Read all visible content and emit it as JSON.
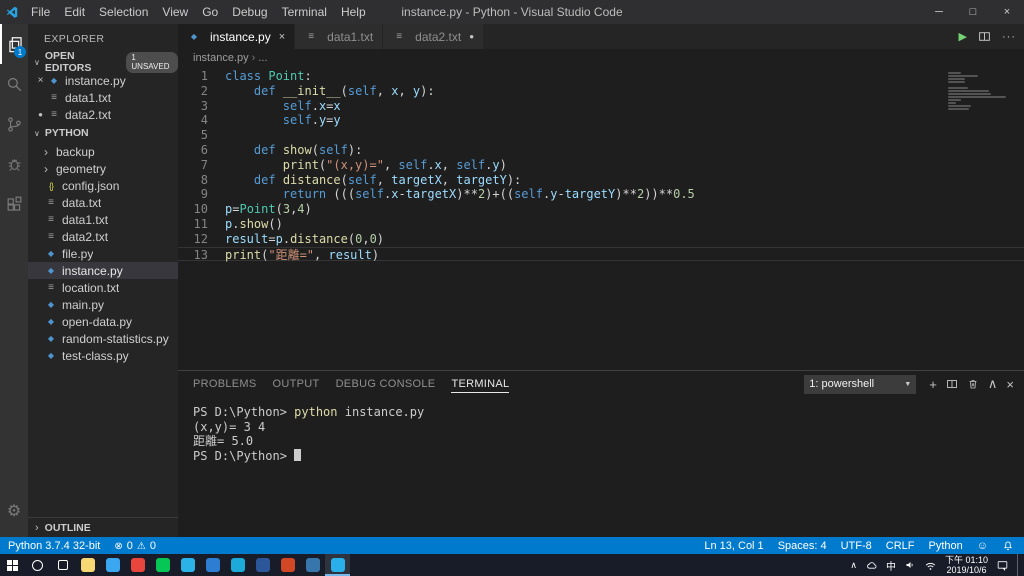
{
  "colors": {
    "accent": "#007acc",
    "token": {
      "k": "#569cd6",
      "c": "#4ec9b0",
      "f": "#dcdcaa",
      "v": "#9cdcfe",
      "s": "#ce9178",
      "d": "#b5cea8",
      "p": "#d4d4d4",
      "y": "#dcdcaa",
      "t": "#cccccc"
    }
  },
  "titlebar": {
    "title": "instance.py - Python - Visual Studio Code",
    "menus": [
      "File",
      "Edit",
      "Selection",
      "View",
      "Go",
      "Debug",
      "Terminal",
      "Help"
    ],
    "controls": {
      "minimize": "─",
      "maximize": "□",
      "close": "×"
    }
  },
  "activity_bar": {
    "badge": "1",
    "items": [
      "explorer",
      "search",
      "source-control",
      "debug",
      "extensions",
      "settings"
    ]
  },
  "sidebar": {
    "title": "EXPLORER",
    "open_editors": {
      "label": "OPEN EDITORS",
      "badge": "1 UNSAVED",
      "items": [
        {
          "name": "instance.py",
          "type": "py",
          "close": true
        },
        {
          "name": "data1.txt",
          "type": "txt"
        },
        {
          "name": "data2.txt",
          "type": "txt",
          "dirty": true
        }
      ]
    },
    "folder": {
      "label": "PYTHON",
      "items": [
        {
          "name": "backup",
          "type": "folder"
        },
        {
          "name": "geometry",
          "type": "folder"
        },
        {
          "name": "config.json",
          "type": "json"
        },
        {
          "name": "data.txt",
          "type": "txt"
        },
        {
          "name": "data1.txt",
          "type": "txt"
        },
        {
          "name": "data2.txt",
          "type": "txt"
        },
        {
          "name": "file.py",
          "type": "py"
        },
        {
          "name": "instance.py",
          "type": "py",
          "selected": true
        },
        {
          "name": "location.txt",
          "type": "txt"
        },
        {
          "name": "main.py",
          "type": "py"
        },
        {
          "name": "open-data.py",
          "type": "py"
        },
        {
          "name": "random-statistics.py",
          "type": "py"
        },
        {
          "name": "test-class.py",
          "type": "py"
        }
      ]
    },
    "outline_label": "OUTLINE"
  },
  "editor": {
    "tabs": [
      {
        "label": "instance.py",
        "type": "py",
        "active": true,
        "close": true
      },
      {
        "label": "data1.txt",
        "type": "txt"
      },
      {
        "label": "data2.txt",
        "type": "txt",
        "dirty": true
      }
    ],
    "action_icons": {
      "run": "▶",
      "more": "···"
    },
    "breadcrumb": {
      "file": "instance.py",
      "more": "..."
    },
    "code": [
      {
        "num": 1,
        "tokens": [
          [
            "k",
            "class"
          ],
          [
            "p",
            " "
          ],
          [
            "c",
            "Point"
          ],
          [
            "p",
            ":"
          ]
        ]
      },
      {
        "num": 2,
        "tokens": [
          [
            "p",
            "    "
          ],
          [
            "k",
            "def"
          ],
          [
            "p",
            " "
          ],
          [
            "f",
            "__init__"
          ],
          [
            "p",
            "("
          ],
          [
            "k",
            "self"
          ],
          [
            "p",
            ", "
          ],
          [
            "v",
            "x"
          ],
          [
            "p",
            ", "
          ],
          [
            "v",
            "y"
          ],
          [
            "p",
            "):"
          ]
        ]
      },
      {
        "num": 3,
        "tokens": [
          [
            "p",
            "        "
          ],
          [
            "k",
            "self"
          ],
          [
            "p",
            "."
          ],
          [
            "v",
            "x"
          ],
          [
            "p",
            "="
          ],
          [
            "v",
            "x"
          ]
        ]
      },
      {
        "num": 4,
        "tokens": [
          [
            "p",
            "        "
          ],
          [
            "k",
            "self"
          ],
          [
            "p",
            "."
          ],
          [
            "v",
            "y"
          ],
          [
            "p",
            "="
          ],
          [
            "v",
            "y"
          ]
        ]
      },
      {
        "num": 5,
        "tokens": []
      },
      {
        "num": 6,
        "tokens": [
          [
            "p",
            "    "
          ],
          [
            "k",
            "def"
          ],
          [
            "p",
            " "
          ],
          [
            "f",
            "show"
          ],
          [
            "p",
            "("
          ],
          [
            "k",
            "self"
          ],
          [
            "p",
            "):"
          ]
        ]
      },
      {
        "num": 7,
        "tokens": [
          [
            "p",
            "        "
          ],
          [
            "f",
            "print"
          ],
          [
            "p",
            "("
          ],
          [
            "s",
            "\"(x,y)=\""
          ],
          [
            "p",
            ", "
          ],
          [
            "k",
            "self"
          ],
          [
            "p",
            "."
          ],
          [
            "v",
            "x"
          ],
          [
            "p",
            ", "
          ],
          [
            "k",
            "self"
          ],
          [
            "p",
            "."
          ],
          [
            "v",
            "y"
          ],
          [
            "p",
            ")"
          ]
        ]
      },
      {
        "num": 8,
        "tokens": [
          [
            "p",
            "    "
          ],
          [
            "k",
            "def"
          ],
          [
            "p",
            " "
          ],
          [
            "f",
            "distance"
          ],
          [
            "p",
            "("
          ],
          [
            "k",
            "self"
          ],
          [
            "p",
            ", "
          ],
          [
            "v",
            "targetX"
          ],
          [
            "p",
            ", "
          ],
          [
            "v",
            "targetY"
          ],
          [
            "p",
            "):"
          ]
        ]
      },
      {
        "num": 9,
        "tokens": [
          [
            "p",
            "        "
          ],
          [
            "k",
            "return"
          ],
          [
            "p",
            " ((("
          ],
          [
            "k",
            "self"
          ],
          [
            "p",
            "."
          ],
          [
            "v",
            "x"
          ],
          [
            "p",
            "-"
          ],
          [
            "v",
            "targetX"
          ],
          [
            "p",
            ")**"
          ],
          [
            "d",
            "2"
          ],
          [
            "p",
            ")+(("
          ],
          [
            "k",
            "self"
          ],
          [
            "p",
            "."
          ],
          [
            "v",
            "y"
          ],
          [
            "p",
            "-"
          ],
          [
            "v",
            "targetY"
          ],
          [
            "p",
            ")**"
          ],
          [
            "d",
            "2"
          ],
          [
            "p",
            "))**"
          ],
          [
            "d",
            "0.5"
          ]
        ]
      },
      {
        "num": 10,
        "tokens": [
          [
            "v",
            "p"
          ],
          [
            "p",
            "="
          ],
          [
            "c",
            "Point"
          ],
          [
            "p",
            "("
          ],
          [
            "d",
            "3"
          ],
          [
            "p",
            ","
          ],
          [
            "d",
            "4"
          ],
          [
            "p",
            ")"
          ]
        ]
      },
      {
        "num": 11,
        "tokens": [
          [
            "v",
            "p"
          ],
          [
            "p",
            "."
          ],
          [
            "f",
            "show"
          ],
          [
            "p",
            "()"
          ]
        ]
      },
      {
        "num": 12,
        "tokens": [
          [
            "v",
            "result"
          ],
          [
            "p",
            "="
          ],
          [
            "v",
            "p"
          ],
          [
            "p",
            "."
          ],
          [
            "f",
            "distance"
          ],
          [
            "p",
            "("
          ],
          [
            "d",
            "0"
          ],
          [
            "p",
            ","
          ],
          [
            "d",
            "0"
          ],
          [
            "p",
            ")"
          ]
        ]
      },
      {
        "num": 13,
        "tokens": [
          [
            "f",
            "print"
          ],
          [
            "p",
            "("
          ],
          [
            "s",
            "\"距離=\""
          ],
          [
            "p",
            ", "
          ],
          [
            "v",
            "result"
          ],
          [
            "p",
            ")"
          ]
        ],
        "current": true
      }
    ]
  },
  "panel": {
    "tabs": [
      {
        "label": "PROBLEMS"
      },
      {
        "label": "OUTPUT"
      },
      {
        "label": "DEBUG CONSOLE"
      },
      {
        "label": "TERMINAL",
        "active": true
      }
    ],
    "shell_select": "1: powershell",
    "icons": {
      "dropdown": "▼",
      "new": "+",
      "maximize": "∧",
      "close": "×"
    },
    "terminal": [
      {
        "tokens": [
          [
            "t",
            "PS D:\\Python> "
          ],
          [
            "y",
            "python"
          ],
          [
            "t",
            " instance.py"
          ]
        ]
      },
      {
        "tokens": [
          [
            "t",
            "(x,y)= 3 4"
          ]
        ]
      },
      {
        "tokens": [
          [
            "t",
            "距離= 5.0"
          ]
        ]
      },
      {
        "tokens": [
          [
            "t",
            "PS D:\\Python> "
          ]
        ],
        "cursor": true
      }
    ]
  },
  "statusbar": {
    "left": {
      "version": "Python 3.7.4 32-bit",
      "errors": "0",
      "warnings": "0"
    },
    "right": [
      {
        "name": "cursor-position",
        "label": "Ln 13, Col 1"
      },
      {
        "name": "indentation",
        "label": "Spaces: 4"
      },
      {
        "name": "encoding",
        "label": "UTF-8"
      },
      {
        "name": "eol",
        "label": "CRLF"
      },
      {
        "name": "language-mode",
        "label": "Python"
      }
    ]
  },
  "taskbar": {
    "apps": [
      {
        "name": "file-explorer",
        "color": "#f8d775"
      },
      {
        "name": "edge",
        "color": "#3aa7f0"
      },
      {
        "name": "chrome",
        "color": "#e8453c"
      },
      {
        "name": "line",
        "color": "#06c755"
      },
      {
        "name": "store",
        "color": "#2bb3e8"
      },
      {
        "name": "photos",
        "color": "#2d7dd2"
      },
      {
        "name": "mail",
        "color": "#1caad9"
      },
      {
        "name": "word",
        "color": "#2b579a"
      },
      {
        "name": "powerpoint",
        "color": "#d24726"
      },
      {
        "name": "python-idle",
        "color": "#3776ab"
      },
      {
        "name": "vscode",
        "color": "#29b0ea",
        "active": true
      }
    ],
    "tray": {
      "ime": "中",
      "time": "下午 01:10",
      "date": "2019/10/6"
    }
  }
}
